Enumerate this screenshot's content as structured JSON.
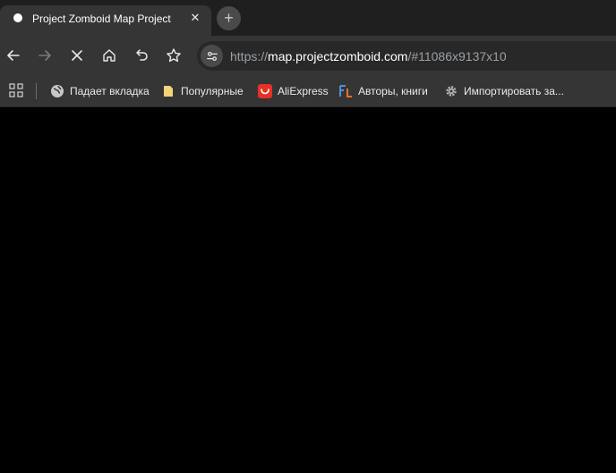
{
  "tab": {
    "title": "Project Zomboid Map Project",
    "close_glyph": "✕",
    "new_tab_glyph": "+"
  },
  "toolbar": {
    "url_scheme": "https://",
    "url_host": "map.projectzomboid.com",
    "url_rest": "/#11086x9137x10"
  },
  "bookmarks": [
    {
      "label": "Падает вкладка",
      "icon": "globe-icon"
    },
    {
      "label": "Популярные",
      "icon": "folder-icon"
    },
    {
      "label": "AliExpress",
      "icon": "aliexpress-icon"
    },
    {
      "label": "Авторы, книги",
      "icon": "fl-icon"
    },
    {
      "label": "Импортировать за...",
      "icon": "gear-icon"
    }
  ],
  "colors": {
    "tabstrip_bg": "#1f1f1f",
    "toolbar_bg": "#353535",
    "omnibox_bg": "#282828",
    "page_bg": "#000000",
    "aliexpress_red": "#e43226",
    "folder_yellow": "#f5d37a"
  }
}
